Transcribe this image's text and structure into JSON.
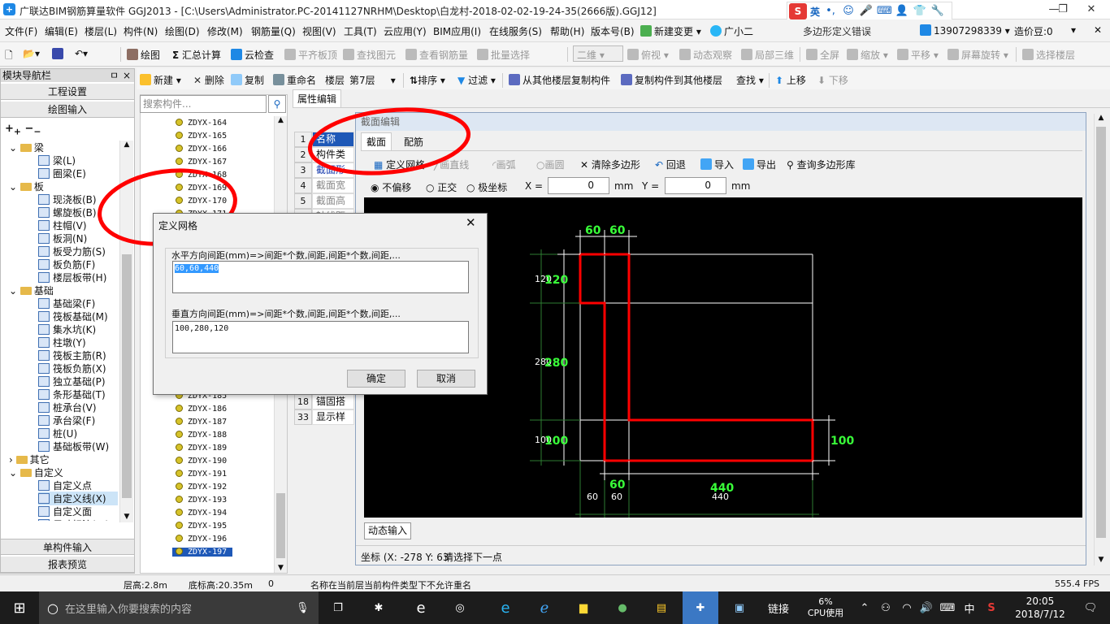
{
  "window": {
    "title": "广联达BIM钢筋算量软件 GGJ2013 - [C:\\Users\\Administrator.PC-20141127NRHM\\Desktop\\白龙村-2018-02-02-19-24-35(2666版).GGJ12]"
  },
  "ime": {
    "label": "英"
  },
  "menu": {
    "items": [
      "文件(F)",
      "编辑(E)",
      "楼层(L)",
      "构件(N)",
      "绘图(D)",
      "修改(M)",
      "钢筋量(Q)",
      "视图(V)",
      "工具(T)",
      "云应用(Y)",
      "BIM应用(I)",
      "在线服务(S)",
      "帮助(H)",
      "版本号(B)"
    ],
    "new_change": "新建变更",
    "assistant": "广小二",
    "notice": "多边形定义错误",
    "phone": "13907298339",
    "price_bean": "造价豆:0"
  },
  "toolbar1": {
    "draw": "绘图",
    "sum": "汇总计算",
    "cloud_check": "云检查",
    "flush_slab": "平齐板顶",
    "find_elem": "查找图元",
    "view_rebar": "查看钢筋量",
    "batch_select": "批量选择",
    "view_mode": "二维",
    "top_view": "俯视",
    "dynamic_view": "动态观察",
    "local_3d": "局部三维",
    "full_screen": "全屏",
    "zoom": "缩放",
    "pan": "平移",
    "rotate": "屏幕旋转",
    "select_floor": "选择楼层"
  },
  "toolbar2": {
    "new": "新建",
    "delete": "删除",
    "copy": "复制",
    "rename": "重命名",
    "floor_label": "楼层",
    "floor_value": "第7层",
    "sort": "排序",
    "filter": "过滤",
    "copy_from": "从其他楼层复制构件",
    "copy_to": "复制构件到其他楼层",
    "find": "查找",
    "move_up": "上移",
    "move_down": "下移"
  },
  "nav": {
    "header": "模块导航栏",
    "pin": "ㅁ",
    "close": "×",
    "project_settings": "工程设置",
    "drawing_input": "绘图输入",
    "single_input": "单构件输入",
    "report_preview": "报表预览",
    "tree": [
      {
        "label": "梁",
        "type": "folder"
      },
      {
        "label": "梁(L)",
        "type": "leaf"
      },
      {
        "label": "圈梁(E)",
        "type": "leaf"
      },
      {
        "label": "板",
        "type": "folder"
      },
      {
        "label": "现浇板(B)",
        "type": "leaf"
      },
      {
        "label": "螺旋板(B)",
        "type": "leaf"
      },
      {
        "label": "柱帽(V)",
        "type": "leaf"
      },
      {
        "label": "板洞(N)",
        "type": "leaf"
      },
      {
        "label": "板受力筋(S)",
        "type": "leaf"
      },
      {
        "label": "板负筋(F)",
        "type": "leaf"
      },
      {
        "label": "楼层板带(H)",
        "type": "leaf"
      },
      {
        "label": "基础",
        "type": "folder"
      },
      {
        "label": "基础梁(F)",
        "type": "leaf"
      },
      {
        "label": "筏板基础(M)",
        "type": "leaf"
      },
      {
        "label": "集水坑(K)",
        "type": "leaf"
      },
      {
        "label": "柱墩(Y)",
        "type": "leaf"
      },
      {
        "label": "筏板主筋(R)",
        "type": "leaf"
      },
      {
        "label": "筏板负筋(X)",
        "type": "leaf"
      },
      {
        "label": "独立基础(P)",
        "type": "leaf"
      },
      {
        "label": "条形基础(T)",
        "type": "leaf"
      },
      {
        "label": "桩承台(V)",
        "type": "leaf"
      },
      {
        "label": "承台梁(F)",
        "type": "leaf"
      },
      {
        "label": "桩(U)",
        "type": "leaf"
      },
      {
        "label": "基础板带(W)",
        "type": "leaf"
      },
      {
        "label": "其它",
        "type": "folder"
      },
      {
        "label": "自定义",
        "type": "folder"
      },
      {
        "label": "自定义点",
        "type": "leaf"
      },
      {
        "label": "自定义线(X)",
        "type": "leaf"
      },
      {
        "label": "自定义面",
        "type": "leaf"
      },
      {
        "label": "尺寸标注(W)",
        "type": "leaf"
      }
    ]
  },
  "components": {
    "search_placeholder": "搜索构件...",
    "top": [
      "ZDYX-164",
      "ZDYX-165",
      "ZDYX-166",
      "ZDYX-167",
      "ZDYX-168",
      "ZDYX-169",
      "ZDYX-170",
      "ZDYX-171"
    ],
    "bottom": [
      "ZDYX-185",
      "ZDYX-186",
      "ZDYX-187",
      "ZDYX-188",
      "ZDYX-189",
      "ZDYX-190",
      "ZDYX-191",
      "ZDYX-192",
      "ZDYX-193",
      "ZDYX-194",
      "ZDYX-195",
      "ZDYX-196",
      "ZDYX-197"
    ]
  },
  "props": {
    "tab": "属性编辑",
    "rows": [
      {
        "no": "1",
        "value": "名称"
      },
      {
        "no": "2",
        "value": "构件类"
      },
      {
        "no": "3",
        "value": "截面形"
      },
      {
        "no": "4",
        "value": "截面宽"
      },
      {
        "no": "5",
        "value": "截面高"
      },
      {
        "no": "6",
        "value": "轴线距"
      }
    ],
    "rows_bottom": [
      {
        "no": "18",
        "value": "锚固搭"
      },
      {
        "no": "33",
        "value": "显示样"
      }
    ]
  },
  "section_editor": {
    "title": "截面编辑",
    "tab_section": "截面",
    "tab_rebar": "配筋",
    "define_grid": "定义网格",
    "line": "画直线",
    "arc": "画弧",
    "circle": "画圆",
    "clear_poly": "清除多边形",
    "undo": "回退",
    "import": "导入",
    "export": "导出",
    "query_lib": "查询多边形库",
    "opt_no_offset": "不偏移",
    "opt_ortho": "正交",
    "opt_polar": "极坐标",
    "x_label": "X =",
    "x_value": "0",
    "y_label": "Y =",
    "y_value": "0",
    "unit": "mm",
    "dynamic_input": "动态输入",
    "coord": "坐标 (X: -278 Y: 63",
    "prompt": "请选择下一点"
  },
  "drawing": {
    "dims": {
      "top1": "60",
      "top2": "60",
      "left1": "120",
      "left2": "280",
      "left3": "100",
      "left1_small": "120",
      "left2_small": "280",
      "left3_small": "100",
      "right": "100",
      "b60": "60",
      "b440": "440",
      "bs60a": "60",
      "bs60b": "60",
      "bs440": "440"
    }
  },
  "dialog": {
    "title": "定义网格",
    "h_label": "水平方向间距(mm)=>间距*个数,间距,间距*个数,间距,...",
    "h_value": "60,60,440",
    "v_label": "垂直方向间距(mm)=>间距*个数,间距,间距*个数,间距,...",
    "v_value": "100,280,120",
    "ok": "确定",
    "cancel": "取消"
  },
  "status": {
    "floor_height": "层高:2.8m",
    "bottom_height": "底标高:20.35m",
    "zero": "0",
    "message": "名称在当前层当前构件类型下不允许重名",
    "fps": "555.4 FPS"
  },
  "taskbar": {
    "search_placeholder": "在这里输入你要搜索的内容",
    "link": "链接",
    "cpu_pct": "6%",
    "cpu_label": "CPU使用",
    "lang": "中",
    "time": "20:05",
    "date": "2018/7/12"
  }
}
